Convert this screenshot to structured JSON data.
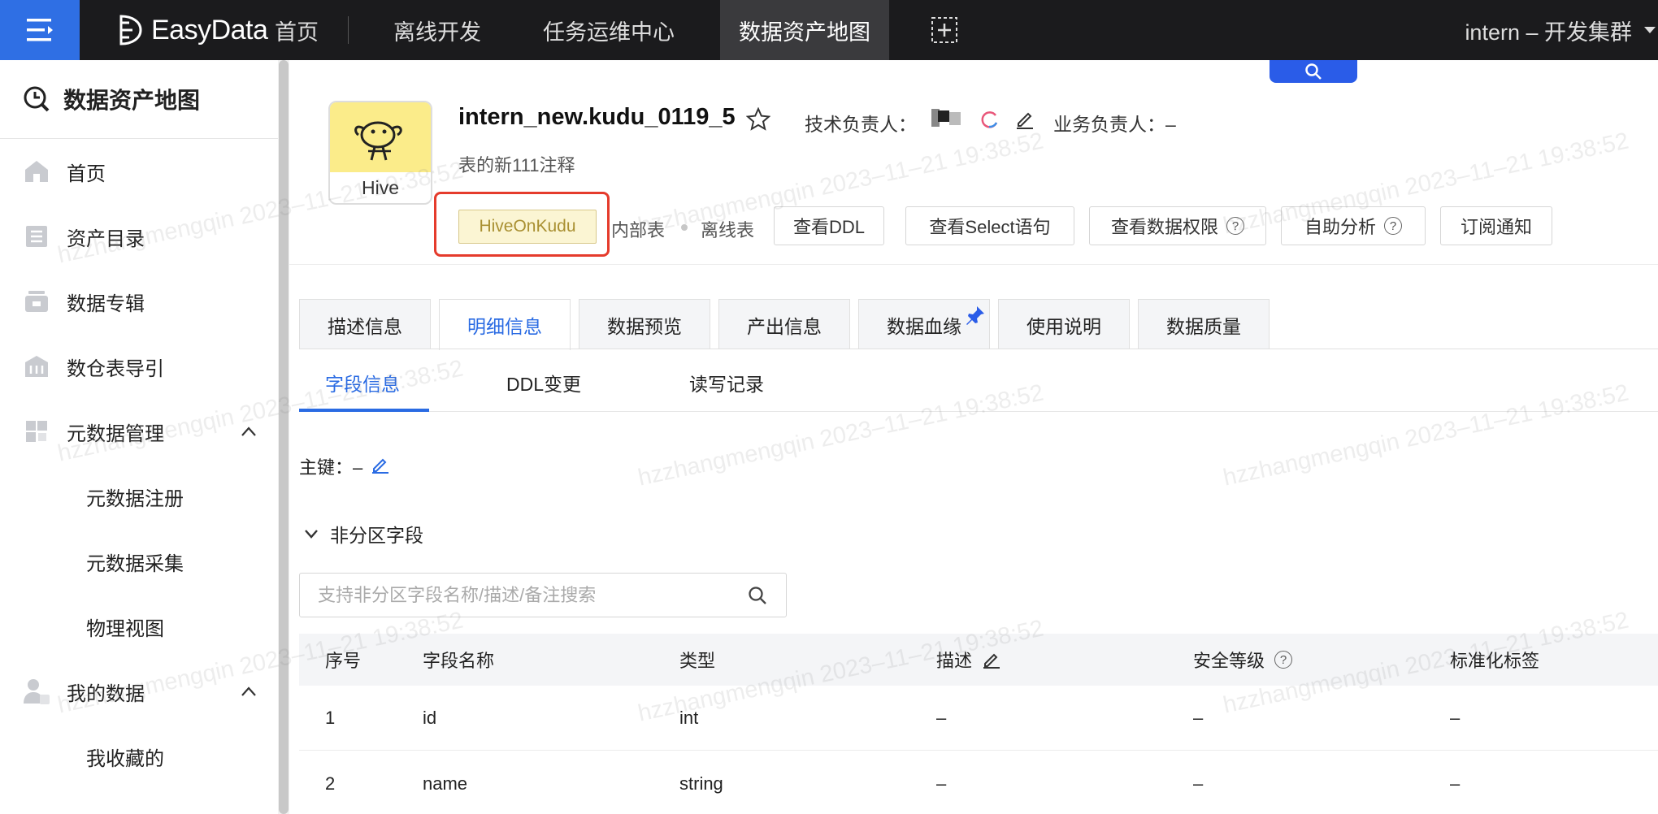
{
  "topbar": {
    "brand": "EasyData",
    "nav": [
      "首页",
      "离线开发",
      "任务运维中心",
      "数据资产地图"
    ],
    "active_nav": "数据资产地图",
    "cluster": "intern – 开发集群"
  },
  "sidebar": {
    "title": "数据资产地图",
    "items": [
      {
        "label": "首页",
        "icon": "home-icon"
      },
      {
        "label": "资产目录",
        "icon": "catalog-icon"
      },
      {
        "label": "数据专辑",
        "icon": "album-icon"
      },
      {
        "label": "数仓表导引",
        "icon": "warehouse-icon"
      },
      {
        "label": "元数据管理",
        "icon": "grid-icon",
        "expanded": true
      },
      {
        "label": "元数据注册"
      },
      {
        "label": "元数据采集"
      },
      {
        "label": "物理视图"
      },
      {
        "label": "我的数据",
        "icon": "user-data-icon",
        "expanded": true
      },
      {
        "label": "我收藏的"
      }
    ]
  },
  "header": {
    "engine_label": "Hive",
    "table_name": "intern_new.kudu_0119_5",
    "tech_owner_label": "技术负责人：",
    "biz_owner_label": "业务负责人：–",
    "comment": "表的新111注释",
    "tag_type": "HiveOnKudu",
    "tag_internal": "内部表",
    "tag_offline": "离线表",
    "buttons": [
      "查看DDL",
      "查看Select语句",
      "查看数据权限",
      "自助分析",
      "订阅通知"
    ]
  },
  "tabs": {
    "main": [
      "描述信息",
      "明细信息",
      "数据预览",
      "产出信息",
      "数据血缘",
      "使用说明",
      "数据质量"
    ],
    "active_main": "明细信息",
    "sub": [
      "字段信息",
      "DDL变更",
      "读写记录"
    ],
    "active_sub": "字段信息"
  },
  "detail": {
    "primary_key_label": "主键：–",
    "section_title": "非分区字段",
    "search_placeholder": "支持非分区字段名称/描述/备注搜索"
  },
  "table": {
    "columns": [
      "序号",
      "字段名称",
      "类型",
      "描述",
      "安全等级",
      "标准化标签"
    ],
    "rows": [
      [
        "1",
        "id",
        "int",
        "–",
        "–",
        "–"
      ],
      [
        "2",
        "name",
        "string",
        "–",
        "–",
        "–"
      ]
    ]
  },
  "watermark": "hzzhangmengqin 2023–11–21 19:38:52",
  "colors": {
    "topbar_bg": "#1b1b1d",
    "menu_btn": "#2f6fe4",
    "accent": "#2a6be3",
    "highlight": "#e53b2c",
    "tag_bg": "#fbf5d3"
  }
}
